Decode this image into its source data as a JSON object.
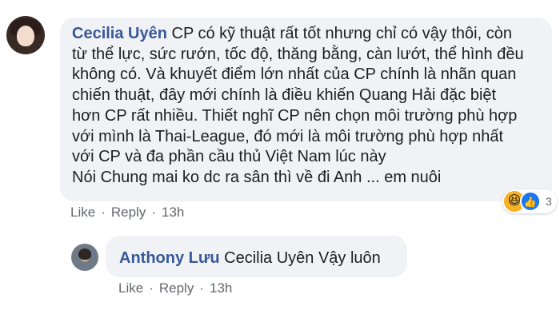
{
  "comment": {
    "author": "Cecilia Uyên",
    "lines": [
      "CP có kỹ thuật rất tốt nhưng chỉ có vậy thôi, còn",
      "từ thể lực, sức rướn, tốc độ, thăng bằng, càn lướt, thể hình đều",
      "không có. Và khuyết điểm lớn nhất của CP chính là nhãn quan",
      "chiến thuật, đây mới chính là điều khiến Quang Hải đặc biệt",
      "hơn CP rất nhiều. Thiết nghĩ CP nên chọn môi trường phù hợp",
      "với mình là Thai-League, đó mới là môi trường phù hợp nhất",
      "với CP và đa phần cầu thủ Việt Nam lúc này",
      "Nói Chung mai ko dc ra sân thì về đi Anh ... em nuôi"
    ],
    "like_label": "Like",
    "reply_label": "Reply",
    "separator": "·",
    "time": "13h",
    "reaction_count": "3",
    "reaction_icons": [
      "haha-icon",
      "like-icon"
    ]
  },
  "reply": {
    "author": "Anthony Lưu",
    "text": "Cecilia Uyên Vậy luôn",
    "like_label": "Like",
    "reply_label": "Reply",
    "separator": "·",
    "time": "13h"
  },
  "colors": {
    "author": "#385898",
    "bubble": "#f0f2f5",
    "meta": "#65676b"
  }
}
